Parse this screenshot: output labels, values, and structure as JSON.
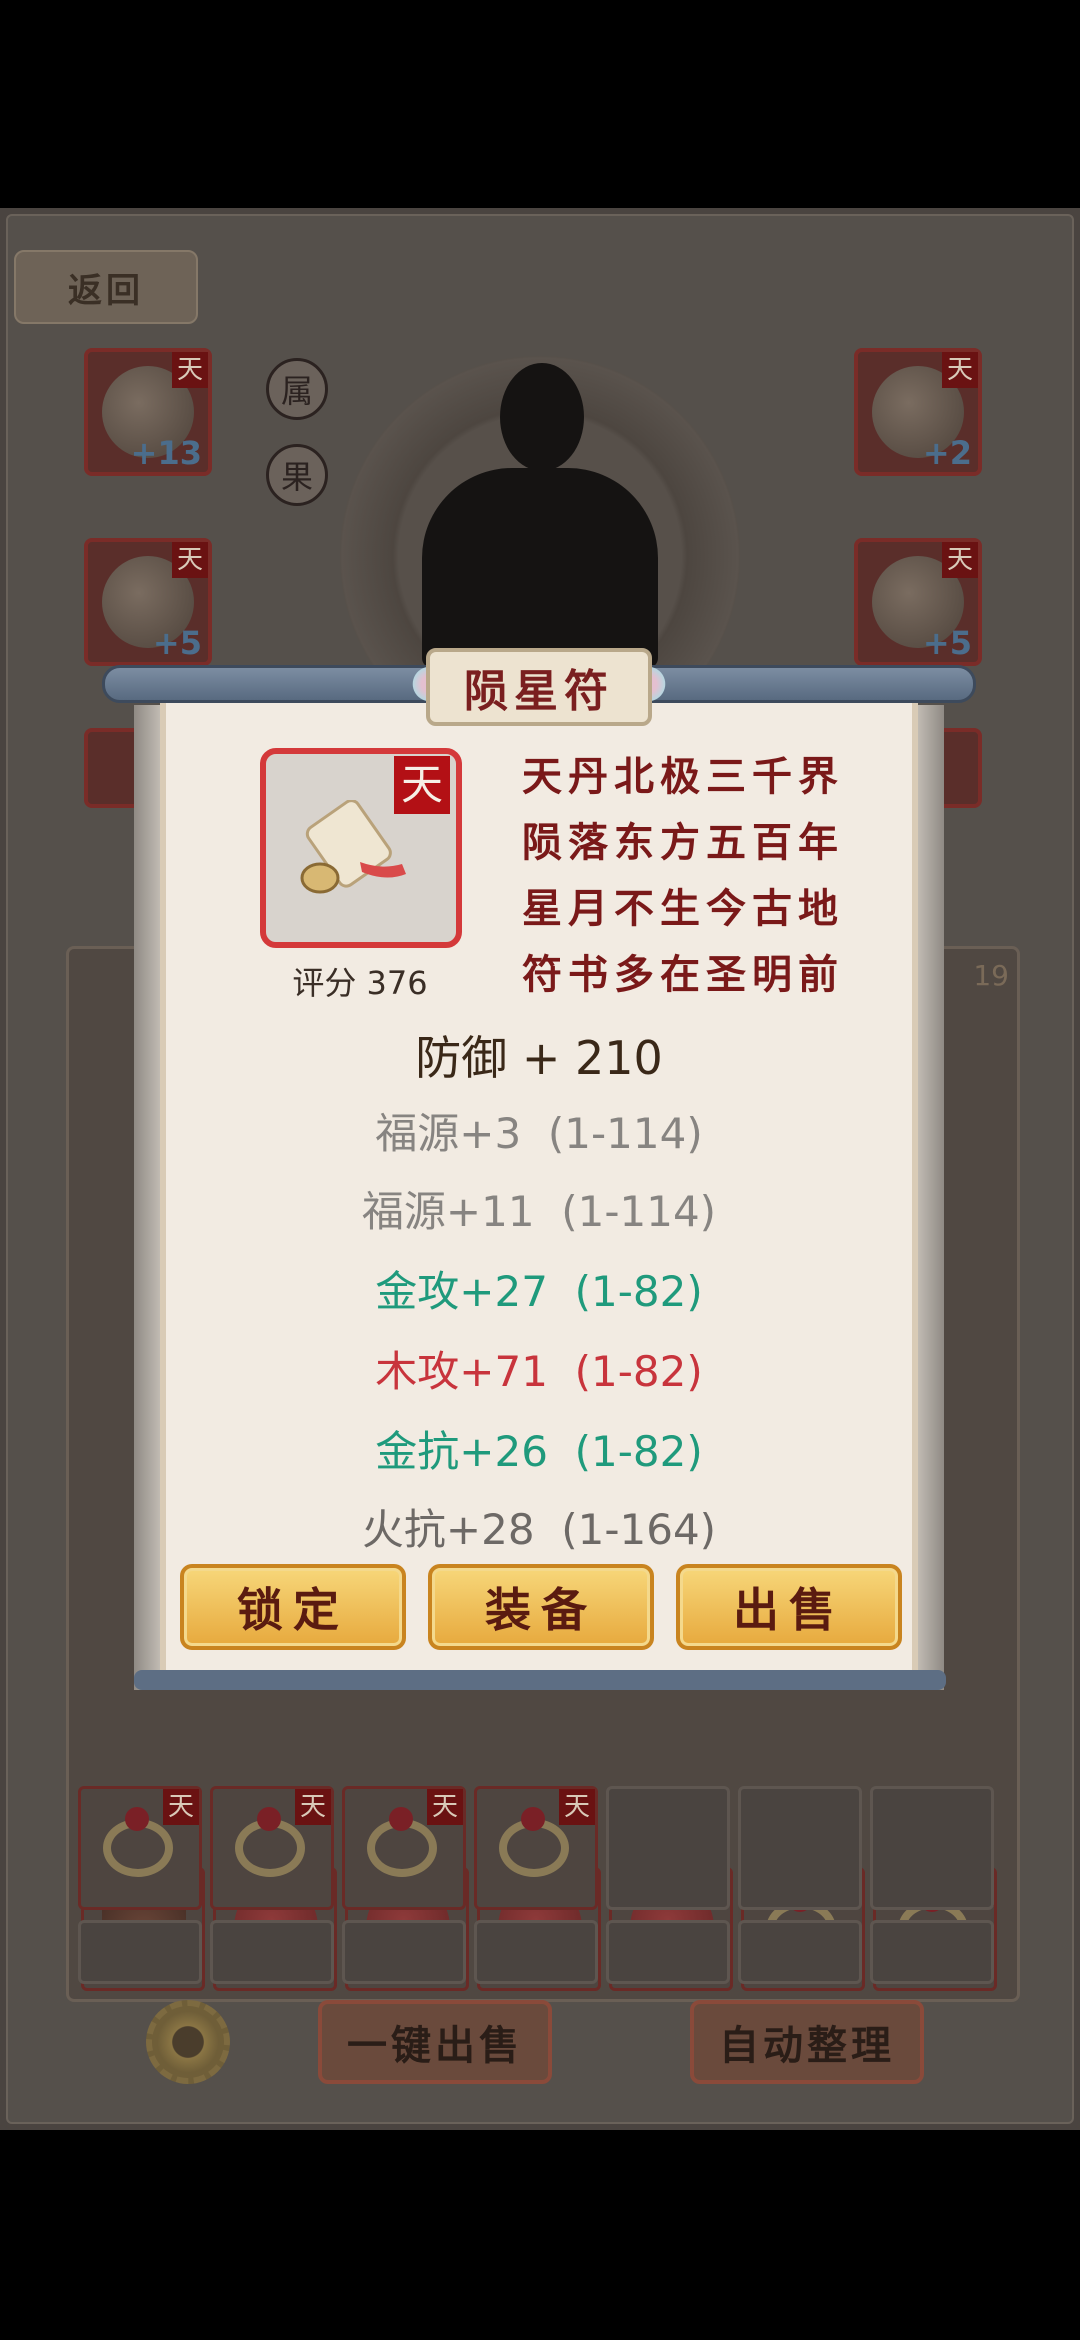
{
  "game": {
    "back_label": "返回",
    "side_buttons": [
      "属",
      "果"
    ],
    "left_slots": [
      {
        "tag": "天",
        "plus": "+13"
      },
      {
        "tag": "天",
        "plus": "+5"
      }
    ],
    "right_slots": [
      {
        "tag": "天",
        "plus": "+2"
      },
      {
        "tag": "天",
        "plus": "+5"
      }
    ],
    "grid_tags": [
      "天",
      "天",
      "天",
      "天",
      "天",
      "天",
      "天",
      "天"
    ],
    "peek_count": "19",
    "bottom_buttons": {
      "sell_all": "一键出售",
      "auto_sort": "自动整理"
    }
  },
  "dialog": {
    "title": "陨星符",
    "item_tag": "天",
    "score": "评分 376",
    "poem": [
      "天丹北极三千界",
      "陨落东方五百年",
      "星月不生今古地",
      "符书多在圣明前"
    ],
    "main_stat": "防御 + 210",
    "stats": [
      {
        "text": "福源+3  (1-114)",
        "color": "gray"
      },
      {
        "text": "福源+11  (1-114)",
        "color": "gray"
      },
      {
        "text": "金攻+27  (1-82)",
        "color": "green"
      },
      {
        "text": "木攻+71  (1-82)",
        "color": "red"
      },
      {
        "text": "金抗+26  (1-82)",
        "color": "green"
      },
      {
        "text": "火抗+28  (1-164)",
        "color": "dark"
      }
    ],
    "buttons": {
      "lock": "锁定",
      "equip": "装备",
      "sell": "出售"
    }
  },
  "colors": {
    "accent_gold": "#f7d77a",
    "title_red": "#7a1f1f",
    "tag_red": "#b31015",
    "stat_green": "#1f9a7c",
    "stat_red": "#c8343c"
  }
}
